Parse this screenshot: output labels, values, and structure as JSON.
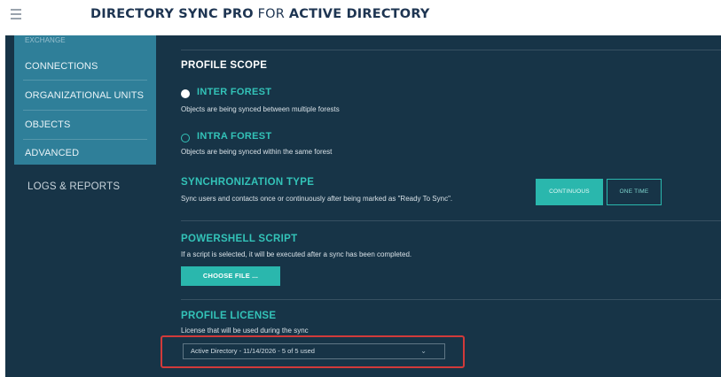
{
  "header": {
    "title_part1": "DIRECTORY SYNC PRO",
    "title_part2": "FOR",
    "title_part3": "ACTIVE DIRECTORY"
  },
  "sidebar": {
    "items": [
      {
        "label": "EXCHANGE",
        "active": false
      },
      {
        "label": "CONNECTIONS",
        "active": false
      },
      {
        "label": "ORGANIZATIONAL UNITS",
        "active": false
      },
      {
        "label": "OBJECTS",
        "active": false
      },
      {
        "label": "ADVANCED",
        "active": false
      }
    ],
    "logs": "LOGS & REPORTS"
  },
  "profile_scope": {
    "title": "PROFILE SCOPE",
    "options": [
      {
        "label": "INTER FOREST",
        "description": "Objects are being synced between multiple forests",
        "selected": true
      },
      {
        "label": "INTRA FOREST",
        "description": "Objects are being synced within the same forest",
        "selected": false
      }
    ]
  },
  "sync_type": {
    "title": "SYNCHRONIZATION TYPE",
    "description": "Sync users and contacts once or continuously after being marked as \"Ready To Sync\".",
    "continuous_label": "CONTINUOUS",
    "one_time_label": "ONE TIME",
    "selected": "CONTINUOUS"
  },
  "powershell": {
    "title": "POWERSHELL SCRIPT",
    "description": "If a script is selected, it will be executed after a sync has been completed.",
    "button_label": "CHOOSE FILE ..."
  },
  "license": {
    "title": "PROFILE LICENSE",
    "description": "License that will be used during the sync",
    "selected_value": "Active Directory - 11/14/2026 - 5 of 5 used"
  },
  "colors": {
    "accent": "#2ab7ad",
    "background": "#173447",
    "sidebar_group": "#2f7f99",
    "highlight": "#d13a3a"
  },
  "icons": {
    "menu": "hamburger-menu-icon",
    "dropdown": "chevron-down-icon"
  }
}
